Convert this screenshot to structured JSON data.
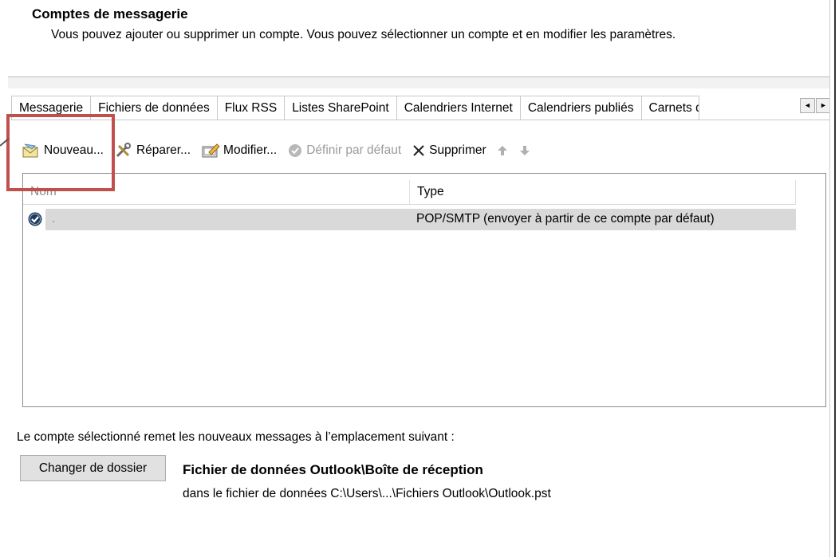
{
  "header": {
    "title": "Comptes de messagerie",
    "subtitle": "Vous pouvez ajouter ou supprimer un compte. Vous pouvez sélectionner un compte et en modifier les paramètres."
  },
  "tabs": [
    {
      "label": "Messagerie",
      "active": true
    },
    {
      "label": "Fichiers de données"
    },
    {
      "label": "Flux RSS"
    },
    {
      "label": "Listes SharePoint"
    },
    {
      "label": "Calendriers Internet"
    },
    {
      "label": "Calendriers publiés"
    },
    {
      "label": "Carnets d"
    }
  ],
  "tab_scroll": {
    "left": "◄",
    "right": "►"
  },
  "toolbar": {
    "new_label": "Nouveau...",
    "repair_label": "Réparer...",
    "modify_label": "Modifier...",
    "default_label": "Définir par défaut",
    "delete_label": "Supprimer"
  },
  "list": {
    "col_name": "Nom",
    "col_type": "Type",
    "rows": [
      {
        "name": ".",
        "type": "POP/SMTP (envoyer à partir de ce compte par défaut)"
      }
    ]
  },
  "delivery": {
    "description": "Le compte sélectionné remet les nouveaux messages à l’emplacement suivant :",
    "change_button": "Changer de dossier",
    "location_title": "Fichier de données Outlook\\Boîte de réception",
    "location_path": "dans le fichier de données C:\\Users\\...\\Fichiers Outlook\\Outlook.pst"
  },
  "colors": {
    "highlight_box": "#c0504d",
    "selection": "#d9d9d9"
  }
}
